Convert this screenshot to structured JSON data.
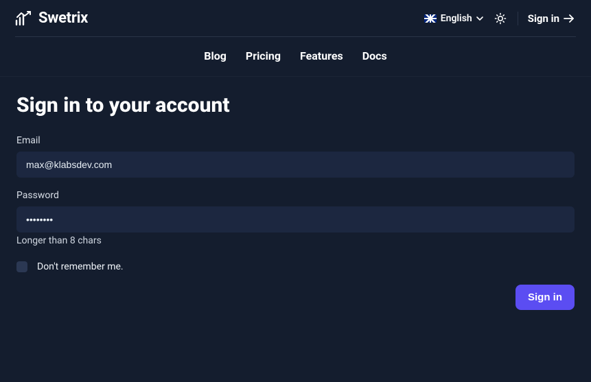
{
  "brand": {
    "name": "Swetrix"
  },
  "header": {
    "language_label": "English",
    "signin_label": "Sign in"
  },
  "nav": {
    "items": [
      {
        "label": "Blog"
      },
      {
        "label": "Pricing"
      },
      {
        "label": "Features"
      },
      {
        "label": "Docs"
      }
    ]
  },
  "page": {
    "title": "Sign in to your account",
    "email_label": "Email",
    "email_value": "max@klabsdev.com",
    "password_label": "Password",
    "password_value": "••••••••",
    "password_hint": "Longer than 8 chars",
    "remember_label": "Don't remember me.",
    "submit_label": "Sign in"
  },
  "colors": {
    "accent": "#5b4df2",
    "bg": "#141d2e",
    "input_bg": "#1c2740"
  }
}
